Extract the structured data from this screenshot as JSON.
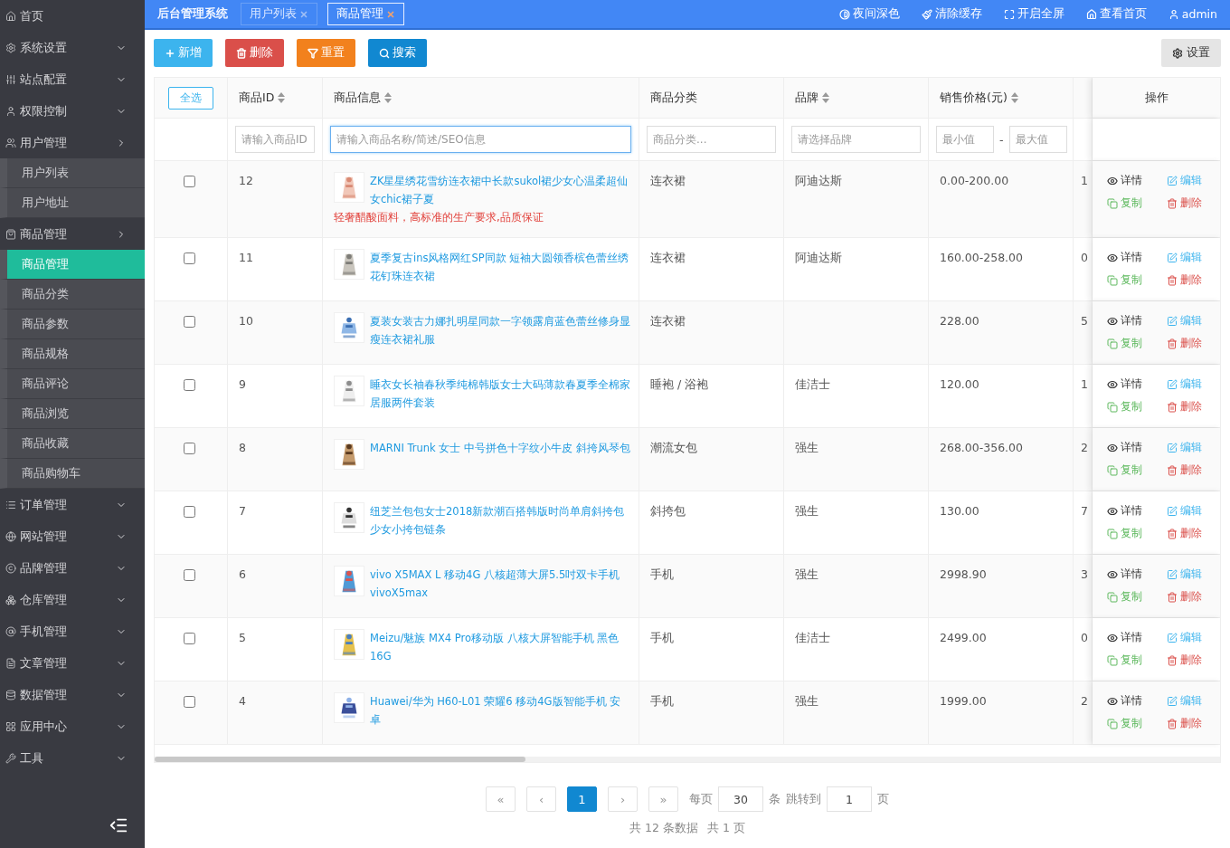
{
  "sidebar": {
    "items": [
      {
        "label": "首页",
        "kind": "link"
      },
      {
        "label": "系统设置",
        "kind": "menu",
        "expanded": false
      },
      {
        "label": "站点配置",
        "kind": "menu",
        "expanded": false
      },
      {
        "label": "权限控制",
        "kind": "menu",
        "expanded": false
      },
      {
        "label": "用户管理",
        "kind": "menu",
        "expanded": true,
        "children": [
          {
            "label": "用户列表",
            "selected": false
          },
          {
            "label": "用户地址",
            "selected": false
          }
        ]
      },
      {
        "label": "商品管理",
        "kind": "menu",
        "expanded": true,
        "children": [
          {
            "label": "商品管理",
            "selected": true
          },
          {
            "label": "商品分类",
            "selected": false
          },
          {
            "label": "商品参数",
            "selected": false
          },
          {
            "label": "商品规格",
            "selected": false
          },
          {
            "label": "商品评论",
            "selected": false
          },
          {
            "label": "商品浏览",
            "selected": false
          },
          {
            "label": "商品收藏",
            "selected": false
          },
          {
            "label": "商品购物车",
            "selected": false
          }
        ]
      },
      {
        "label": "订单管理",
        "kind": "menu",
        "expanded": false
      },
      {
        "label": "网站管理",
        "kind": "menu",
        "expanded": false
      },
      {
        "label": "品牌管理",
        "kind": "menu",
        "expanded": false
      },
      {
        "label": "仓库管理",
        "kind": "menu",
        "expanded": false
      },
      {
        "label": "手机管理",
        "kind": "menu",
        "expanded": false
      },
      {
        "label": "文章管理",
        "kind": "menu",
        "expanded": false
      },
      {
        "label": "数据管理",
        "kind": "menu",
        "expanded": false
      },
      {
        "label": "应用中心",
        "kind": "menu",
        "expanded": false
      },
      {
        "label": "工具",
        "kind": "menu",
        "expanded": false
      }
    ]
  },
  "topbar": {
    "title": "后台管理系统",
    "tabs": [
      {
        "label": "用户列表",
        "selected": false
      },
      {
        "label": "商品管理",
        "selected": true
      }
    ],
    "actions": [
      "夜间深色",
      "清除缓存",
      "开启全屏",
      "查看首页",
      "admin"
    ]
  },
  "toolbar": {
    "buttons": [
      {
        "label": "新增",
        "kind": "add"
      },
      {
        "label": "删除",
        "kind": "delete"
      },
      {
        "label": "重置",
        "kind": "reset"
      },
      {
        "label": "搜索",
        "kind": "search"
      }
    ],
    "settings": "设置"
  },
  "table": {
    "select_all": "全选",
    "columns": [
      {
        "label": "商品ID",
        "sortable": true
      },
      {
        "label": "商品信息",
        "sortable": true
      },
      {
        "label": "商品分类",
        "sortable": false
      },
      {
        "label": "品牌",
        "sortable": true
      },
      {
        "label": "销售价格(元)",
        "sortable": true
      }
    ],
    "actions_column": "操作",
    "filters": [
      {
        "kind": "text",
        "placeholder": "请输入商品ID",
        "focused": false
      },
      {
        "kind": "text",
        "placeholder": "请输入商品名称/简述/SEO信息",
        "focused": true
      },
      {
        "kind": "text",
        "placeholder": "商品分类...",
        "focused": false
      },
      {
        "kind": "text",
        "placeholder": "请选择品牌",
        "focused": false
      },
      {
        "kind": "range",
        "placeholder": "最小值",
        "separator": "-",
        "placeholder_max": "最大值",
        "focused": false
      }
    ],
    "rows": [
      {
        "checked": false,
        "id": "12",
        "title": "ZK星星绣花雪纺连衣裙中长款sukol裙少女心温柔超仙女chic裙子夏",
        "subtitle": "轻奢醋酸面料，高标准的生产要求,品质保证",
        "category": "连衣裙",
        "brand": "阿迪达斯",
        "price": "0.00-200.00",
        "column_7": "1",
        "actions": [
          "详情",
          "编辑",
          "复制",
          "删除"
        ]
      },
      {
        "checked": false,
        "id": "11",
        "title": "夏季复古ins风格网红SP同款 短袖大圆领香槟色蕾丝绣花钉珠连衣裙",
        "category": "连衣裙",
        "brand": "阿迪达斯",
        "price": "160.00-258.00",
        "column_7": "0",
        "actions": [
          "详情",
          "编辑",
          "复制",
          "删除"
        ]
      },
      {
        "checked": false,
        "id": "10",
        "title": "夏装女装古力娜扎明星同款一字领露肩蓝色蕾丝修身显瘦连衣裙礼服",
        "category": "连衣裙",
        "price": "228.00",
        "column_7": "5",
        "actions": [
          "详情",
          "编辑",
          "复制",
          "删除"
        ]
      },
      {
        "checked": false,
        "id": "9",
        "title": "睡衣女长袖春秋季纯棉韩版女士大码薄款春夏季全棉家居服两件套装",
        "category": "睡袍 / 浴袍",
        "brand": "佳洁士",
        "price": "120.00",
        "column_7": "1",
        "actions": [
          "详情",
          "编辑",
          "复制",
          "删除"
        ]
      },
      {
        "checked": false,
        "id": "8",
        "title": "MARNI Trunk 女士 中号拼色十字纹小牛皮 斜挎风琴包",
        "category": "潮流女包",
        "brand": "强生",
        "price": "268.00-356.00",
        "column_7": "2",
        "actions": [
          "详情",
          "编辑",
          "复制",
          "删除"
        ]
      },
      {
        "checked": false,
        "id": "7",
        "title": "纽芝兰包包女士2018新款潮百搭韩版时尚单肩斜挎包少女小挎包链条",
        "category": "斜挎包",
        "brand": "强生",
        "price": "130.00",
        "column_7": "7",
        "actions": [
          "详情",
          "编辑",
          "复制",
          "删除"
        ]
      },
      {
        "checked": false,
        "id": "6",
        "title": "vivo X5MAX L 移动4G 八核超薄大屏5.5吋双卡手机vivoX5max",
        "category": "手机",
        "brand": "强生",
        "price": "2998.90",
        "column_7": "3",
        "actions": [
          "详情",
          "编辑",
          "复制",
          "删除"
        ]
      },
      {
        "checked": false,
        "id": "5",
        "title": "Meizu/魅族 MX4 Pro移动版 八核大屏智能手机 黑色16G",
        "category": "手机",
        "brand": "佳洁士",
        "price": "2499.00",
        "column_7": "0",
        "actions": [
          "详情",
          "编辑",
          "复制",
          "删除"
        ]
      },
      {
        "checked": false,
        "id": "4",
        "title": "Huawei/华为 H60-L01 荣耀6 移动4G版智能手机 安卓",
        "category": "手机",
        "brand": "强生",
        "price": "1999.00",
        "column_7": "2",
        "actions": [
          "详情",
          "编辑",
          "复制",
          "删除"
        ]
      }
    ]
  },
  "pagination": {
    "first": "«",
    "prev": "‹",
    "pages": [
      {
        "label": "1",
        "selected": true
      }
    ],
    "next": "›",
    "last": "»",
    "per_page_label": "每页",
    "per_page": "30",
    "per_page_unit": "条",
    "jump_label": "跳转到",
    "jump_value": "1",
    "jump_unit": "页",
    "summary": "共 12 条数据",
    "total_pages": "共 1 页"
  }
}
